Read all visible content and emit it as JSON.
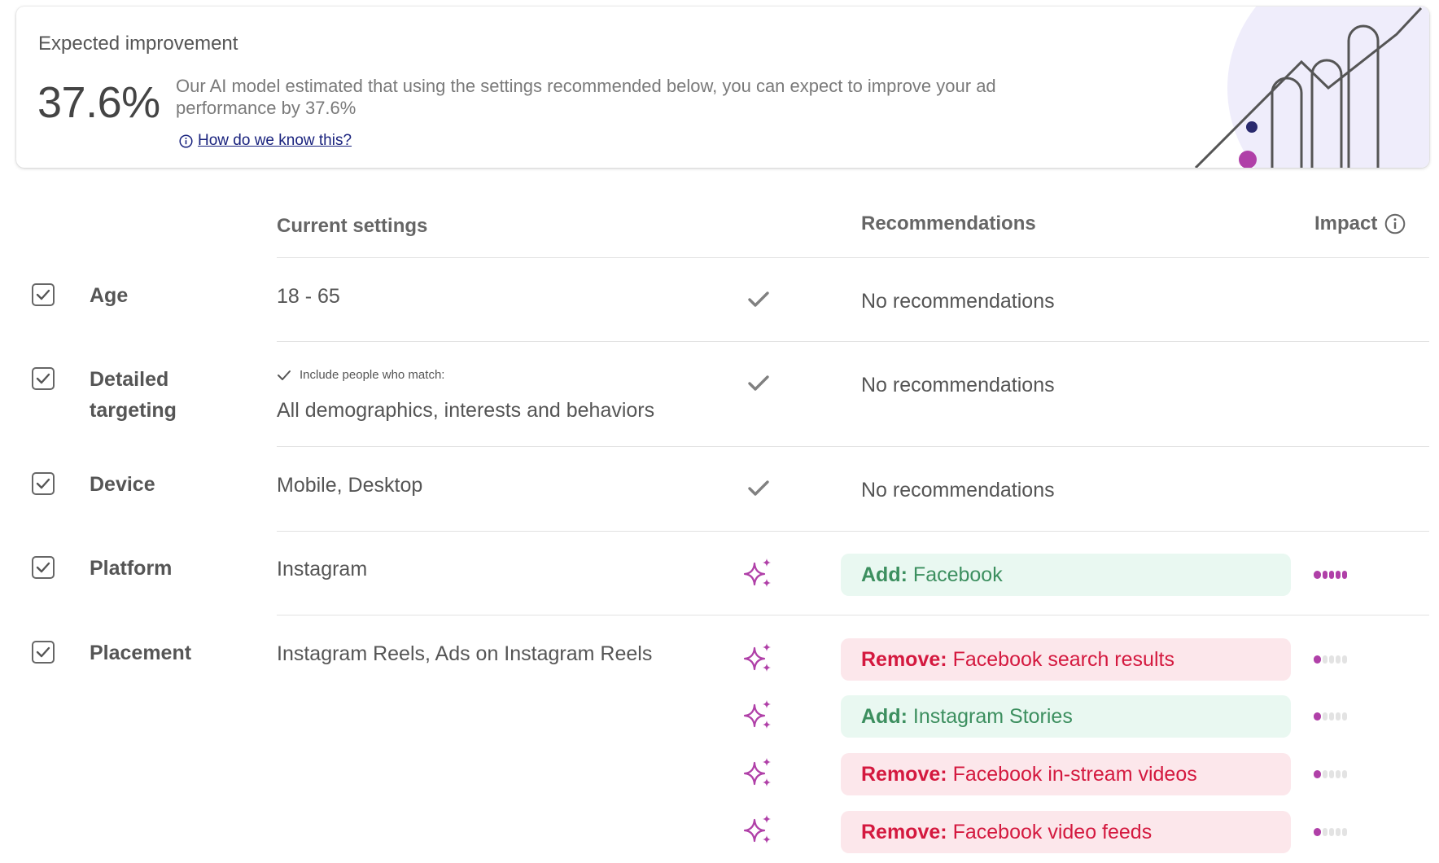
{
  "summary": {
    "title": "Expected improvement",
    "value": "37.6%",
    "description": "Our AI model estimated that using the settings recommended below, you can expect to improve your ad performance by 37.6%",
    "link_label": "How do we know this?",
    "illustration_icon": "growth-chart-illustration"
  },
  "table": {
    "headers": {
      "current": "Current settings",
      "recommendations": "Recommendations",
      "impact": "Impact"
    },
    "rows": [
      {
        "label": "Age",
        "value": "18 - 65",
        "checked": true,
        "status_icon": "check-icon",
        "recommendation": "No recommendations"
      },
      {
        "label": "Detailed targeting",
        "note": "Include people who match:",
        "value": "All demographics, interests and behaviors",
        "checked": true,
        "status_icon": "check-icon",
        "recommendation": "No recommendations"
      },
      {
        "label": "Device",
        "value": "Mobile, Desktop",
        "checked": true,
        "status_icon": "check-icon",
        "recommendation": "No recommendations"
      },
      {
        "label": "Platform",
        "value": "Instagram",
        "checked": true,
        "status_icon": "sparkle-icon",
        "recommendations": [
          {
            "action": "Add:",
            "target": "Facebook",
            "type": "add",
            "impact": 5
          }
        ]
      },
      {
        "label": "Placement",
        "value": "Instagram Reels, Ads on Instagram Reels",
        "checked": true,
        "status_icon": "sparkle-icon",
        "recommendations": [
          {
            "action": "Remove:",
            "target": "Facebook search results",
            "type": "remove",
            "impact": 1
          },
          {
            "action": "Add:",
            "target": "Instagram Stories",
            "type": "add",
            "impact": 1
          },
          {
            "action": "Remove:",
            "target": "Facebook in-stream videos",
            "type": "remove",
            "impact": 1
          },
          {
            "action": "Remove:",
            "target": "Facebook video feeds",
            "type": "remove",
            "impact": 1
          }
        ]
      }
    ],
    "impact_max": 5
  },
  "colors": {
    "accent_purple": "#b040a8",
    "add_bg": "#e9f8f1",
    "add_text": "#3c8f5f",
    "remove_bg": "#fce7eb",
    "remove_text": "#d4193f",
    "link": "#1a237e"
  }
}
